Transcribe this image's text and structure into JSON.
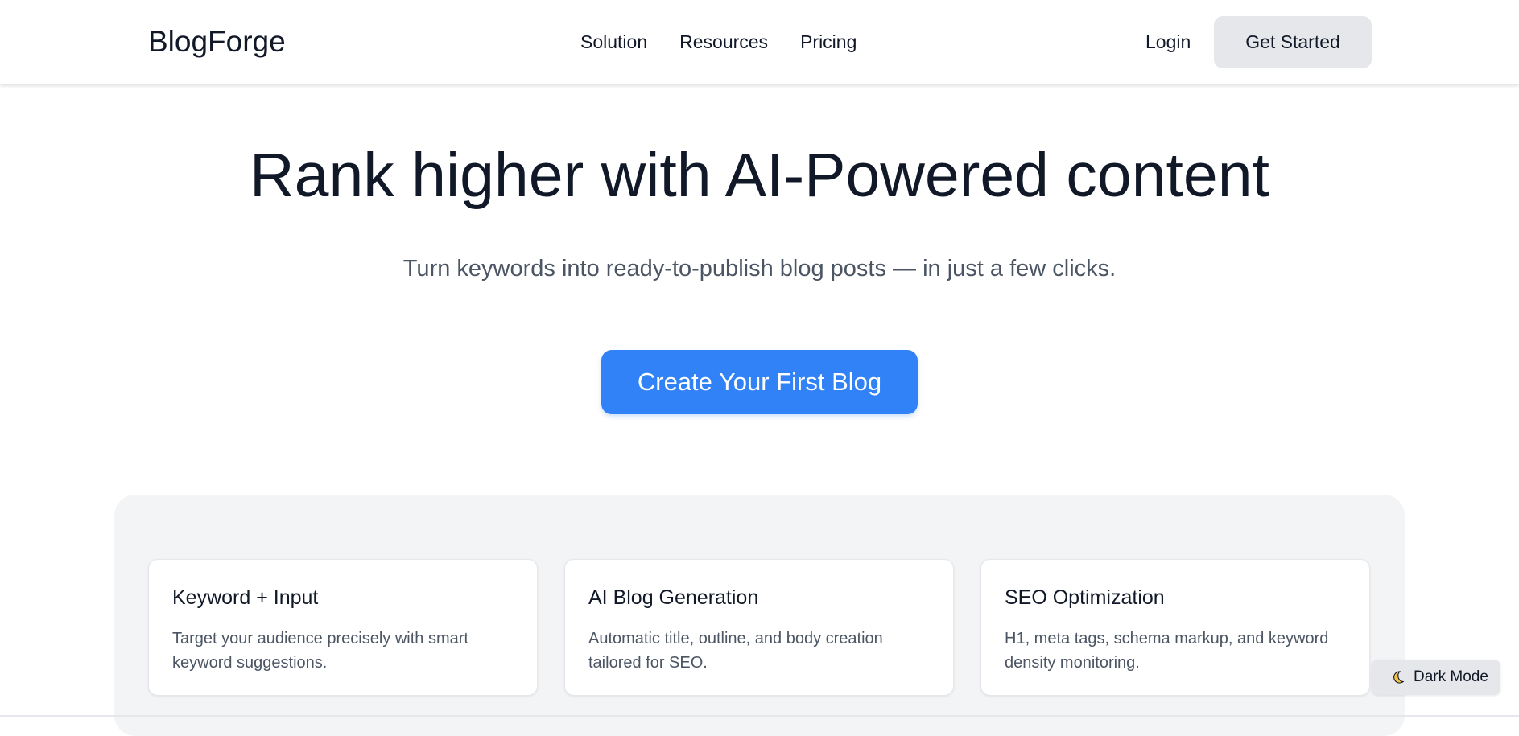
{
  "nav": {
    "brand": "BlogForge",
    "links": [
      "Solution",
      "Resources",
      "Pricing"
    ],
    "login": "Login",
    "cta": "Get Started"
  },
  "hero": {
    "title": "Rank higher with AI-Powered content",
    "subtitle": "Turn keywords into ready-to-publish blog posts — in just a few clicks.",
    "cta": "Create Your First Blog"
  },
  "features": [
    {
      "title": "Keyword + Input",
      "description": "Target your audience precisely with smart keyword suggestions."
    },
    {
      "title": "AI Blog Generation",
      "description": "Automatic title, outline, and body creation tailored for SEO."
    },
    {
      "title": "SEO Optimization",
      "description": "H1, meta tags, schema markup, and keyword density monitoring."
    }
  ],
  "theme_toggle": {
    "icon": "moon-icon",
    "label": "Dark Mode"
  },
  "colors": {
    "accent": "#3082f6",
    "panel": "#f3f4f6",
    "button_secondary": "#e5e7eb"
  }
}
